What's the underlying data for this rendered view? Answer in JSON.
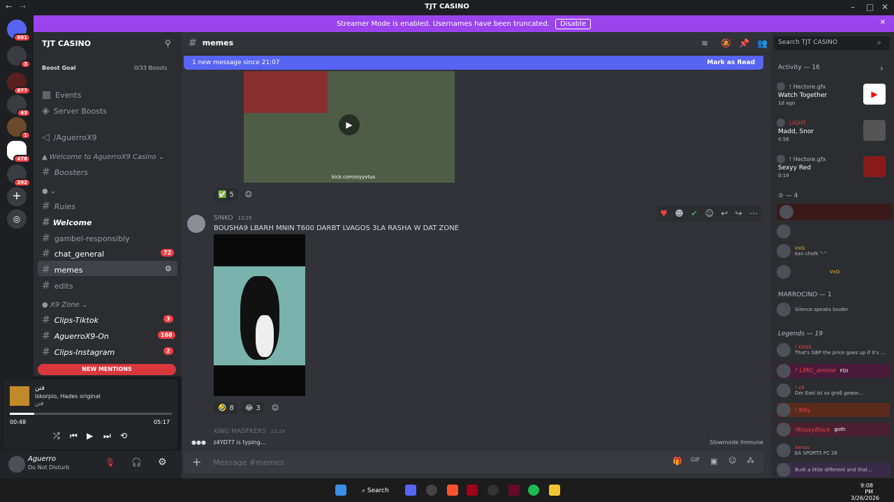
{
  "window": {
    "title": "TJT CASINO"
  },
  "banner": {
    "text": "Streamer Mode is enabled. Usernames have been truncated.",
    "button": "Disable"
  },
  "guild_badges": [
    "991",
    "3",
    "877",
    "43",
    "1",
    "478",
    "392"
  ],
  "server": {
    "name": "TJT CASINO",
    "boost_goal": "Boost Goal",
    "boosts": "0/33 Boosts"
  },
  "channels": {
    "events": "Events",
    "server_boosts": "Server Boosts",
    "aguerro": "/AguerroX9",
    "cat_welcome": "Welcome to AguerroX9 Casino",
    "boosters": "Boosters",
    "cat_dot": "",
    "rules": "Rules",
    "welcome": "Welcome",
    "gambel": "gambel-responsibly",
    "chat_general": "chat_general",
    "chat_general_badge": "72",
    "memes": "memes",
    "edits": "edits",
    "cat_x9": "X9 Zone",
    "tiktok": "Clips-Tiktok",
    "tiktok_badge": "3",
    "on": "AguerroX9-On",
    "on_badge": "168",
    "insta": "Clips-Instagram",
    "insta_badge": "2",
    "new_mentions": "NEW MENTIONS"
  },
  "player": {
    "title": "فتن",
    "artist": "Iskorpio, Hades original",
    "sub": "فتن",
    "elapsed": "00:48",
    "total": "05:17",
    "progress": 0.15
  },
  "user": {
    "name": "Aguerro",
    "status": "Do Not Disturb"
  },
  "chat": {
    "channel": "memes",
    "new_msg_bar": "1 new message since 21:07",
    "mark_read": "Mark as Read",
    "video_link": "kick.com/siyyvtus",
    "react1": "5",
    "author": "SINKO",
    "time": "13:25",
    "message": "BOUSHA9 LBARH MNIN T600 DARBT LVAGOS 3LA RASHA W DAT ZONE",
    "react2a": "8",
    "react2b": "3",
    "next_author": "KING MADFKERS",
    "next_time": "13:29",
    "typing": "z4YD77 is typing...",
    "slowmode": "Slowmode Immune",
    "placeholder": "Message #memes"
  },
  "members": {
    "search": "Search TJT CASINO",
    "activity": "Activity — 16",
    "a1_user": "! Hectore.gfx",
    "a1_title": "Watch Together",
    "a1_time": "1d ago",
    "a2_user": "LIGHT",
    "a2_title": "Madd, Snor",
    "a2_time": "0:56",
    "a3_user": "! Hectore.gfx",
    "a3_title": "Sexyy Red",
    "a3_time": "0:19",
    "group1": "4",
    "m_tag": "VxG",
    "m_status": "kan chofk \"-\"",
    "marrocino": "MARROCINO — 1",
    "marr_status": "Silence speaks louder",
    "legends": "Legends — 19",
    "l1": "! KAGE",
    "l1_status": "That's GBP the price goes up if it's ...",
    "l2": "! LMG_amine",
    "l2_tag": "FDI",
    "l3": "! x9",
    "l3_status": "Der Esel ist so groß gewor...",
    "l4": "! Billy",
    "l5": "!RisskyBlack",
    "l5_tag": "goth",
    "l6": "Aenzo",
    "l6_status": "EA SPORTS FC 26",
    "l7_status": "Built a little different and that..."
  },
  "taskbar": {
    "search": "Search",
    "time": "9:08 PM",
    "date": "3/26/2026"
  }
}
